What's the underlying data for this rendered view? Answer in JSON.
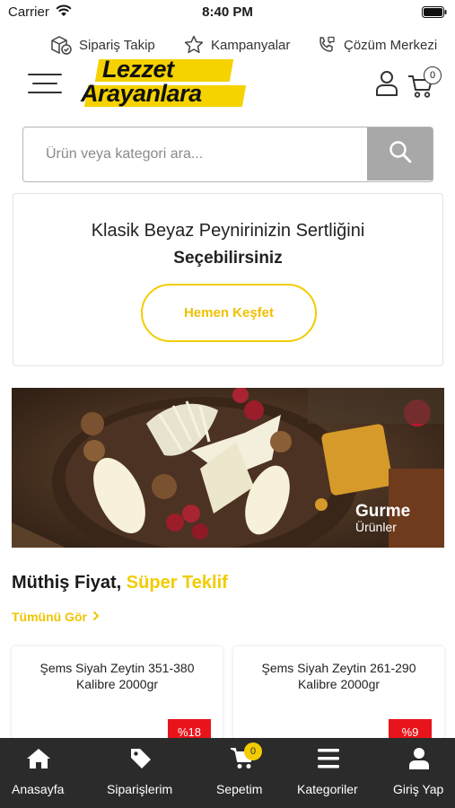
{
  "status_bar": {
    "carrier": "Carrier",
    "time": "8:40 PM"
  },
  "utility_nav": {
    "order_tracking": "Sipariş Takip",
    "campaigns": "Kampanyalar",
    "support": "Çözüm Merkezi"
  },
  "header": {
    "logo_line1": "Lezzet",
    "logo_line2": "Arayanlara",
    "cart_count": "0"
  },
  "search": {
    "placeholder": "Ürün veya kategori ara..."
  },
  "promo": {
    "line1": "Klasik Beyaz Peynirinizin Sertliğini",
    "line2": "Seçebilirsiniz",
    "button": "Hemen Keşfet"
  },
  "banner": {
    "title": "Gurme",
    "subtitle": "Ürünler"
  },
  "deals": {
    "title_main": "Müthiş Fiyat,",
    "title_highlight": "Süper Teklif",
    "see_all": "Tümünü Gör",
    "products": [
      {
        "name": "Şems Siyah Zeytin 351-380 Kalibre 2000gr",
        "discount": "%18"
      },
      {
        "name": "Şems Siyah Zeytin 261-290 Kalibre 2000gr",
        "discount": "%9"
      }
    ]
  },
  "bottom_nav": {
    "home": "Anasayfa",
    "orders": "Siparişlerim",
    "cart": "Sepetim",
    "cart_badge": "0",
    "categories": "Kategoriler",
    "login": "Giriş Yap"
  },
  "colors": {
    "brand_yellow": "#f2cc00",
    "discount_red": "#e8141c",
    "nav_background": "#2b2b2b"
  }
}
